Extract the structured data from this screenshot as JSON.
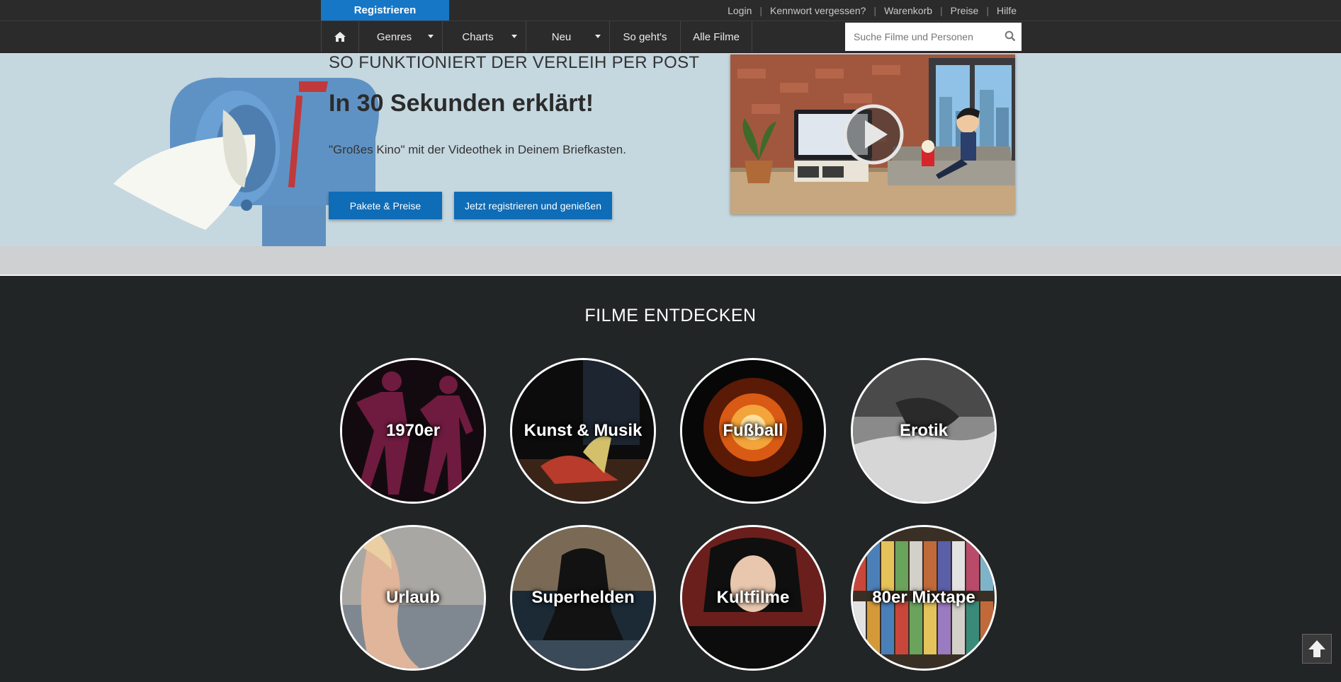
{
  "topbar": {
    "register_label": "Registrieren",
    "links": [
      "Login",
      "Kennwort vergessen?",
      "Warenkorb",
      "Preise",
      "Hilfe"
    ]
  },
  "nav": {
    "home_icon": "home-icon",
    "items": [
      {
        "label": "Genres",
        "dropdown": true
      },
      {
        "label": "Charts",
        "dropdown": true
      },
      {
        "label": "Neu",
        "dropdown": true
      },
      {
        "label": "So geht's",
        "dropdown": false
      },
      {
        "label": "Alle Filme",
        "dropdown": false
      }
    ],
    "search_placeholder": "Suche Filme und Personen"
  },
  "hero": {
    "kicker": "SO FUNKTIONIERT DER VERLEIH PER POST",
    "title": "In 30 Sekunden erklärt!",
    "subtitle": "\"Großes Kino\" mit der Videothek in Deinem Briefkasten.",
    "button_primary": "Pakete & Preise",
    "button_secondary": "Jetzt registrieren und genießen"
  },
  "discover": {
    "title": "FILME ENTDECKEN",
    "categories": [
      "1970er",
      "Kunst & Musik",
      "Fußball",
      "Erotik",
      "Urlaub",
      "Superhelden",
      "Kultfilme",
      "80er Mixtape"
    ]
  },
  "colors": {
    "accent": "#1677c7",
    "button": "#0f6cb6",
    "hero_bg": "#c5d7df",
    "dark_bg": "#222526"
  }
}
